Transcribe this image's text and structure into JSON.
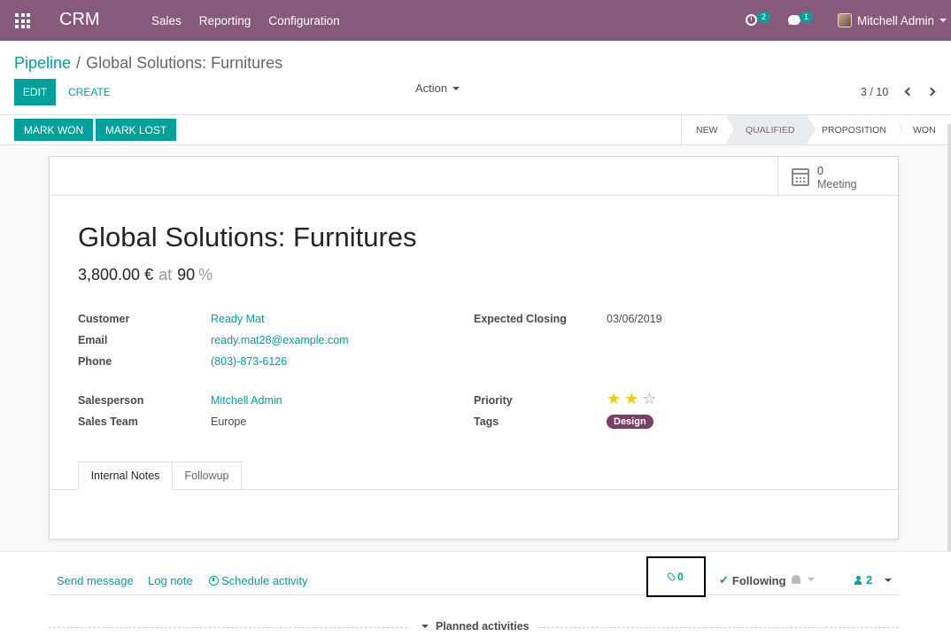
{
  "navbar": {
    "brand": "CRM",
    "menu": [
      "Sales",
      "Reporting",
      "Configuration"
    ],
    "activity_count": "2",
    "message_count": "1",
    "user_name": "Mitchell Admin"
  },
  "breadcrumb": {
    "parent": "Pipeline",
    "separator": "/",
    "current": "Global Solutions: Furnitures"
  },
  "toolbar": {
    "edit_label": "EDIT",
    "create_label": "CREATE",
    "action_label": "Action",
    "pager": "3 / 10"
  },
  "statusbar": {
    "won_label": "MARK WON",
    "lost_label": "MARK LOST",
    "stages": [
      {
        "label": "NEW",
        "active": false
      },
      {
        "label": "QUALIFIED",
        "active": true
      },
      {
        "label": "PROPOSITION",
        "active": false
      },
      {
        "label": "WON",
        "active": false
      }
    ]
  },
  "smart_button": {
    "count": "0",
    "label": "Meeting",
    "icon": "calendar-icon"
  },
  "record": {
    "title": "Global Solutions: Furnitures",
    "revenue": "3,800.00 €",
    "at_label": "at",
    "probability": "90",
    "percent_sign": "%",
    "fields": {
      "customer_label": "Customer",
      "customer": "Ready Mat",
      "email_label": "Email",
      "email": "ready.mat28@example.com",
      "phone_label": "Phone",
      "phone": "(803)-873-6126",
      "salesperson_label": "Salesperson",
      "salesperson": "Mitchell Admin",
      "team_label": "Sales Team",
      "team": "Europe",
      "closing_label": "Expected Closing",
      "closing": "03/06/2019",
      "priority_label": "Priority",
      "priority_stars": 2,
      "priority_max": 3,
      "tags_label": "Tags",
      "tag": "Design"
    }
  },
  "tabs": [
    "Internal Notes",
    "Followup"
  ],
  "chatter": {
    "send_message": "Send message",
    "log_note": "Log note",
    "schedule_activity": "Schedule activity",
    "attachments": "0",
    "following": "Following",
    "followers": "2",
    "planned_activities": "Planned activities"
  },
  "colors": {
    "brand": "#875a7b",
    "primary": "#00a09d",
    "tag": "#7b3e64",
    "star": "#f3cc00"
  }
}
